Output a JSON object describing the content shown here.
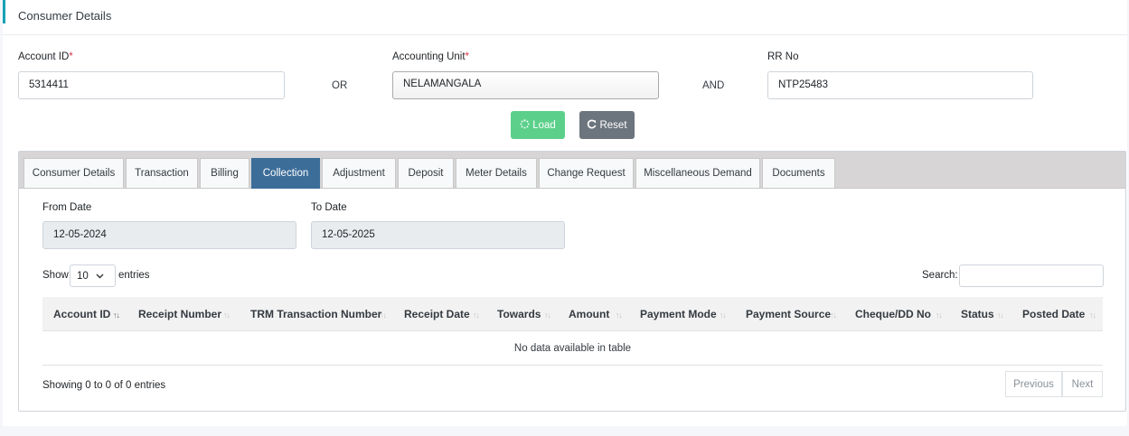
{
  "header": {
    "title": "Consumer Details"
  },
  "form": {
    "account_id_label": "Account ID",
    "account_id_value": "5314411",
    "accounting_unit_label": "Accounting Unit",
    "accounting_unit_value": "NELAMANGALA",
    "rr_no_label": "RR No",
    "rr_no_value": "NTP25483",
    "required_mark": "*",
    "or_text": "OR",
    "and_text": "AND",
    "load_label": "Load",
    "reset_label": "Reset",
    "load_icon": "spinner-icon",
    "reset_icon": "refresh-icon"
  },
  "tabs": [
    {
      "label": "Consumer Details"
    },
    {
      "label": "Transaction"
    },
    {
      "label": "Billing"
    },
    {
      "label": "Collection",
      "active": true
    },
    {
      "label": "Adjustment"
    },
    {
      "label": "Deposit"
    },
    {
      "label": "Meter Details"
    },
    {
      "label": "Change Request"
    },
    {
      "label": "Miscellaneous Demand"
    },
    {
      "label": "Documents"
    }
  ],
  "collection": {
    "from_date_label": "From Date",
    "from_date_value": "12-05-2024",
    "to_date_label": "To Date",
    "to_date_value": "12-05-2025",
    "show_label": "Show",
    "entries_value": "10",
    "entries_label": "entries",
    "search_label": "Search:",
    "search_value": "",
    "columns": [
      "Account ID",
      "Receipt Number",
      "TRM Transaction Number",
      "Receipt Date",
      "Towards",
      "Amount",
      "Payment Mode",
      "Payment Source",
      "Cheque/DD No",
      "Status",
      "Posted Date"
    ],
    "empty_text": "No data available in table",
    "info_text": "Showing 0 to 0 of 0 entries",
    "previous_label": "Previous",
    "next_label": "Next"
  },
  "colors": {
    "accent": "#17a2b8",
    "active_tab": "#3c6d99",
    "load_button": "#5cd08b",
    "reset_button": "#6c757d",
    "required": "#dc3545"
  }
}
